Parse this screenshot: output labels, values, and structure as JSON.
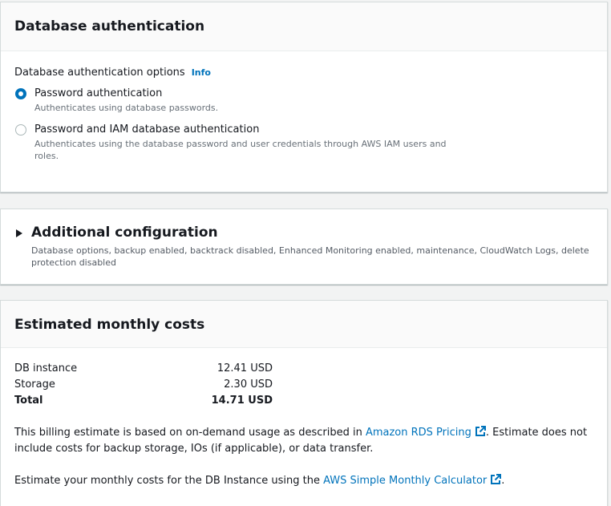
{
  "auth": {
    "title": "Database authentication",
    "options_label": "Database authentication options",
    "info_label": "Info",
    "options": [
      {
        "label": "Password authentication",
        "description": "Authenticates using database passwords.",
        "checked": true
      },
      {
        "label": "Password and IAM database authentication",
        "description": "Authenticates using the database password and user credentials through AWS IAM users and roles.",
        "checked": false
      }
    ]
  },
  "additional": {
    "title": "Additional configuration",
    "description": "Database options, backup enabled, backtrack disabled, Enhanced Monitoring enabled, maintenance, CloudWatch Logs, delete protection disabled"
  },
  "costs": {
    "title": "Estimated monthly costs",
    "rows": [
      {
        "label": "DB instance",
        "value": "12.41 USD"
      },
      {
        "label": "Storage",
        "value": "2.30 USD"
      },
      {
        "label": "Total",
        "value": "14.71 USD"
      }
    ],
    "billing_text_before": "This billing estimate is based on on-demand usage as described in ",
    "billing_link": "Amazon RDS Pricing",
    "billing_text_after": ". Estimate does not include costs for backup storage, IOs (if applicable), or data transfer.",
    "calc_text_before": "Estimate your monthly costs for the DB Instance using the ",
    "calc_link": "AWS Simple Monthly Calculator",
    "calc_text_after": "."
  },
  "colors": {
    "accent": "#0073bb",
    "text": "#16191f",
    "muted": "#687078"
  },
  "icons": {
    "external_link": "external-link-icon",
    "caret": "caret-right-icon"
  }
}
